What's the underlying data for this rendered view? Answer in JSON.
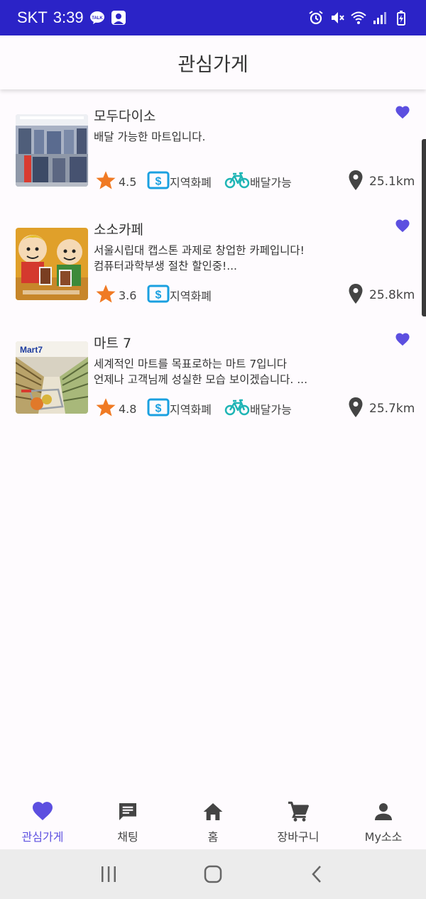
{
  "status_bar": {
    "carrier": "SKT",
    "time": "3:39",
    "talk_badge": "TALK",
    "icons": [
      "kakaotalk-icon",
      "profile-icon",
      "alarm-icon",
      "mute-icon",
      "wifi-icon",
      "signal-icon",
      "battery-icon"
    ]
  },
  "app_bar": {
    "title": "관심가게"
  },
  "stores": [
    {
      "name": "모두다이소",
      "description": "배달 가능한 마트입니다.",
      "rating": "4.5",
      "local_currency": "지역화폐",
      "delivery": "배달가능",
      "distance": "25.1km",
      "favorited": true
    },
    {
      "name": "소소카페",
      "description": "서울시립대 캡스톤 과제로 창업한 카페입니다!\n컴퓨터과학부생 절찬 할인중!...",
      "rating": "3.6",
      "local_currency": "지역화폐",
      "delivery": "",
      "distance": "25.8km",
      "favorited": true
    },
    {
      "name": "마트 7",
      "description": "세계적인 마트를 목표로하는 마트 7입니다\n언제나 고객님께 성실한 모습 보이겠습니다. ...",
      "rating": "4.8",
      "local_currency": "지역화폐",
      "delivery": "배달가능",
      "distance": "25.7km",
      "favorited": true,
      "thumb_sign": "Mart7"
    }
  ],
  "bottom_nav": [
    {
      "label": "관심가게",
      "icon": "heart-icon",
      "active": true
    },
    {
      "label": "채팅",
      "icon": "chat-icon",
      "active": false
    },
    {
      "label": "홈",
      "icon": "home-icon",
      "active": false
    },
    {
      "label": "장바구니",
      "icon": "cart-icon",
      "active": false
    },
    {
      "label": "My소소",
      "icon": "person-icon",
      "active": false
    }
  ],
  "colors": {
    "status_bar": "#2b23c7",
    "accent": "#5c4fe0",
    "star": "#f07a24",
    "currency": "#1aa0e0",
    "bike": "#1fb5b5",
    "pin": "#444444"
  }
}
